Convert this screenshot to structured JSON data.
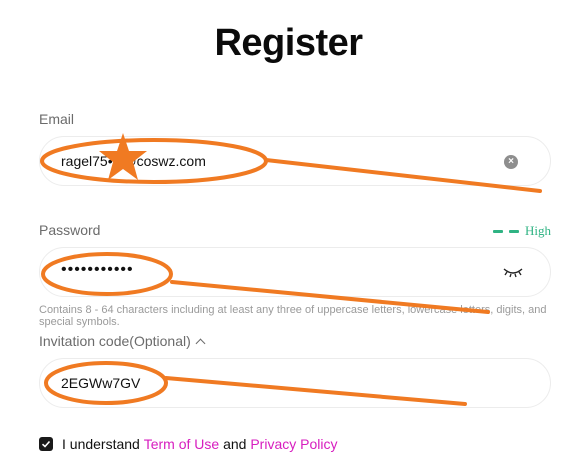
{
  "header": {
    "title": "Register"
  },
  "email": {
    "label": "Email",
    "value": "ragel75•••@coswz.com"
  },
  "password": {
    "label": "Password",
    "value": "•••••••••••",
    "strength": "High"
  },
  "hint": "Contains 8 - 64 characters including at least any three of uppercase letters, lowercase letters, digits, and special symbols.",
  "invitation": {
    "label": "Invitation code(Optional)",
    "value": "2EGWw7GV"
  },
  "terms": {
    "text": "I understand",
    "term_link": "Term of Use",
    "and": "and",
    "privacy_link": "Privacy Policy",
    "checked": true
  },
  "colors": {
    "accent_link": "#d71dbf",
    "strength": "#2fb383",
    "annotation": "#f07a22"
  }
}
